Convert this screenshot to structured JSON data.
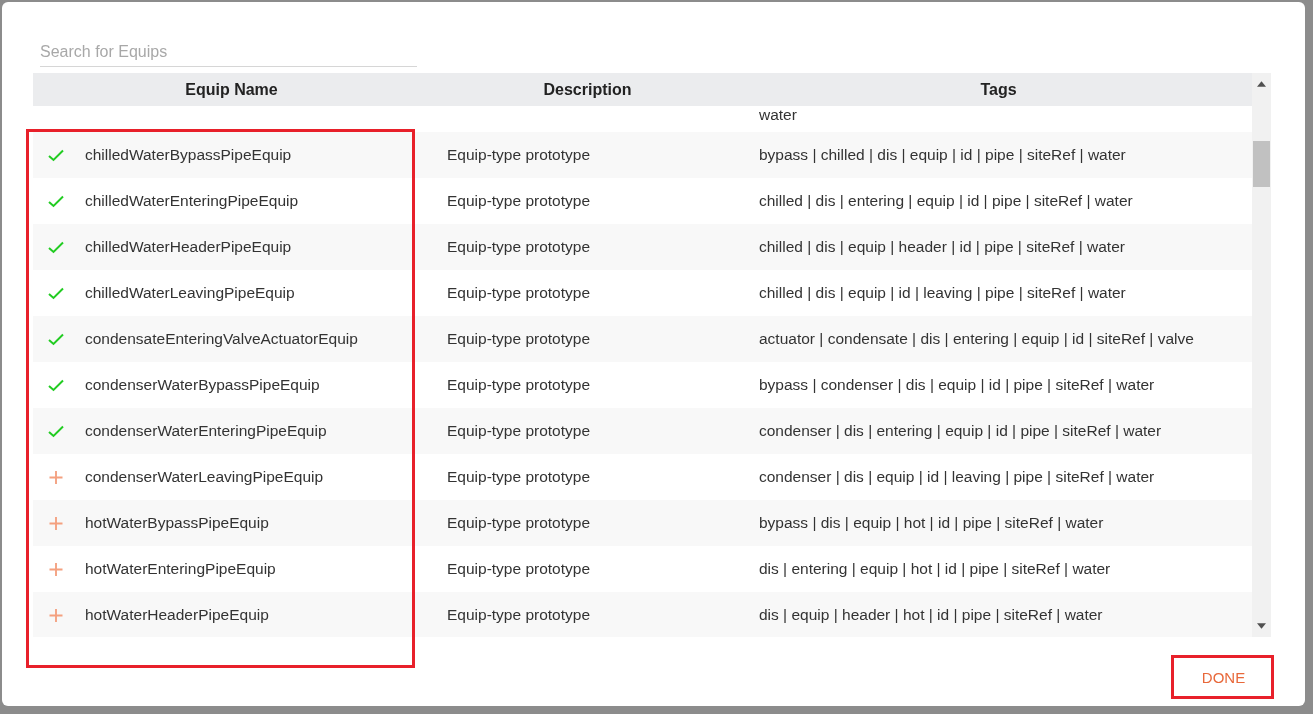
{
  "search": {
    "placeholder": "Search for Equips"
  },
  "table": {
    "columns": [
      "Equip Name",
      "Description",
      "Tags"
    ],
    "partial_row": {
      "tags": "water"
    },
    "rows": [
      {
        "name": "chilledWaterBypassPipeEquip",
        "description": "Equip-type prototype",
        "tags": "bypass | chilled | dis | equip | id | pipe | siteRef | water",
        "added": true
      },
      {
        "name": "chilledWaterEnteringPipeEquip",
        "description": "Equip-type prototype",
        "tags": "chilled | dis | entering | equip | id | pipe | siteRef | water",
        "added": true
      },
      {
        "name": "chilledWaterHeaderPipeEquip",
        "description": "Equip-type prototype",
        "tags": "chilled | dis | equip | header | id | pipe | siteRef | water",
        "added": true
      },
      {
        "name": "chilledWaterLeavingPipeEquip",
        "description": "Equip-type prototype",
        "tags": "chilled | dis | equip | id | leaving | pipe | siteRef | water",
        "added": true
      },
      {
        "name": "condensateEnteringValveActuatorEquip",
        "description": "Equip-type prototype",
        "tags": "actuator | condensate | dis | entering | equip | id | siteRef | valve",
        "added": true
      },
      {
        "name": "condenserWaterBypassPipeEquip",
        "description": "Equip-type prototype",
        "tags": "bypass | condenser | dis | equip | id | pipe | siteRef | water",
        "added": true
      },
      {
        "name": "condenserWaterEnteringPipeEquip",
        "description": "Equip-type prototype",
        "tags": "condenser | dis | entering | equip | id | pipe | siteRef | water",
        "added": true
      },
      {
        "name": "condenserWaterLeavingPipeEquip",
        "description": "Equip-type prototype",
        "tags": "condenser | dis | equip | id | leaving | pipe | siteRef | water",
        "added": false
      },
      {
        "name": "hotWaterBypassPipeEquip",
        "description": "Equip-type prototype",
        "tags": "bypass | dis | equip | hot | id | pipe | siteRef | water",
        "added": false
      },
      {
        "name": "hotWaterEnteringPipeEquip",
        "description": "Equip-type prototype",
        "tags": "dis | entering | equip | hot | id | pipe | siteRef | water",
        "added": false
      },
      {
        "name": "hotWaterHeaderPipeEquip",
        "description": "Equip-type prototype",
        "tags": "dis | equip | header | hot | id | pipe | siteRef | water",
        "added": false
      }
    ],
    "name_column_highlighted": true
  },
  "done_button": {
    "label": "DONE",
    "highlighted": true
  }
}
